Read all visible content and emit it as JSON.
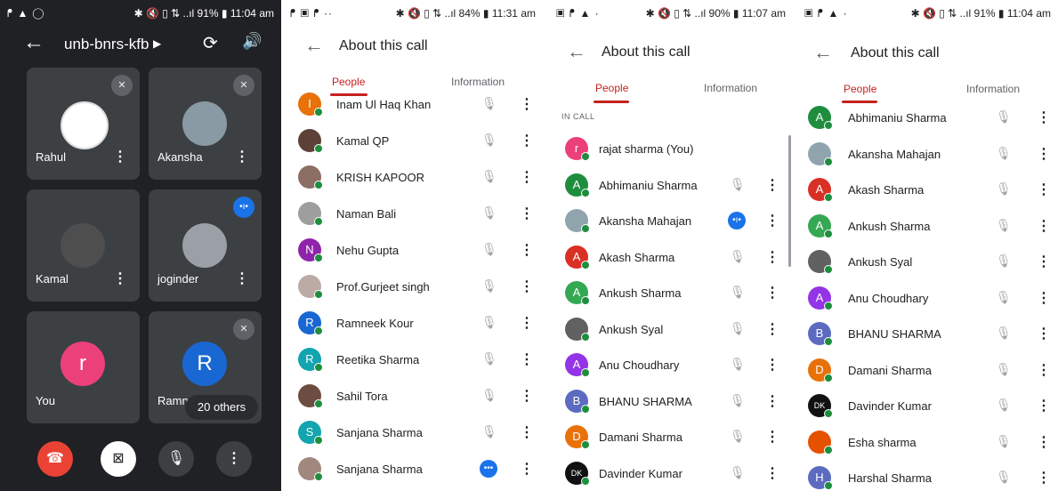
{
  "meet": {
    "status": {
      "left": "ᖰ ▲ ◯",
      "right": "✱ 🔇 ▯ ⇅ ..ıl 91% ▮ 11:04 am"
    },
    "meeting_code": "unb-bnrs-kfb",
    "tiles": [
      {
        "name": "Rahul",
        "muted": true
      },
      {
        "name": "Akansha",
        "muted": true
      },
      {
        "name": "Kamal",
        "muted": false
      },
      {
        "name": "joginder",
        "speaking": true
      },
      {
        "name": "You",
        "initial": "r",
        "color": "#ec407a"
      },
      {
        "name": "Ramne",
        "initial": "R",
        "color": "#1967d2",
        "muted": true
      }
    ],
    "others_label": "20 others"
  },
  "panel2": {
    "status": {
      "left": "ᖰ ▣ ᖰ ··",
      "right": "✱ 🔇 ▯ ⇅ ..ıl 84% ▮ 11:31 am"
    },
    "title": "About this call",
    "tabs": {
      "people": "People",
      "information": "Information"
    },
    "rows": [
      {
        "name": "Inam Ul Haq Khan",
        "initial": "I",
        "color": "#e8710a"
      },
      {
        "name": "Kamal QP",
        "initial": "",
        "color": "#5d4037"
      },
      {
        "name": "KRISH KAPOOR",
        "initial": "",
        "color": "#8d6e63"
      },
      {
        "name": "Naman Bali",
        "initial": "",
        "color": "#9e9e9e"
      },
      {
        "name": "Nehu Gupta",
        "initial": "N",
        "color": "#8e24aa"
      },
      {
        "name": "Prof.Gurjeet singh",
        "initial": "",
        "color": "#bcaaa4"
      },
      {
        "name": "Ramneek Kour",
        "initial": "R",
        "color": "#1967d2"
      },
      {
        "name": "Reetika Sharma",
        "initial": "R",
        "color": "#12a4af"
      },
      {
        "name": "Sahil Tora",
        "initial": "",
        "color": "#6d4c41"
      },
      {
        "name": "Sanjana Sharma",
        "initial": "S",
        "color": "#12a4af"
      },
      {
        "name": "Sanjana Sharma",
        "initial": "",
        "color": "#a1887f",
        "status": "dots"
      }
    ]
  },
  "panel3": {
    "status": {
      "left": "▣ ᖰ ▲ ·",
      "right": "✱ 🔇 ▯ ⇅ ..ıl 90% ▮ 11:07 am"
    },
    "title": "About this call",
    "tabs": {
      "people": "People",
      "information": "Information"
    },
    "in_call": "IN CALL",
    "rows": [
      {
        "name": "rajat sharma (You)",
        "initial": "r",
        "color": "#ec407a",
        "self": true
      },
      {
        "name": "Abhimaniu Sharma",
        "initial": "A",
        "color": "#1e8e3e"
      },
      {
        "name": "Akansha Mahajan",
        "initial": "",
        "color": "#90a4ae",
        "status": "speaking"
      },
      {
        "name": "Akash Sharma",
        "initial": "A",
        "color": "#d93025"
      },
      {
        "name": "Ankush Sharma",
        "initial": "A",
        "color": "#34a853"
      },
      {
        "name": "Ankush Syal",
        "initial": "",
        "color": "#616161"
      },
      {
        "name": "Anu Choudhary",
        "initial": "A",
        "color": "#9334e6"
      },
      {
        "name": "BHANU SHARMA",
        "initial": "B",
        "color": "#5c6bc0"
      },
      {
        "name": "Damani Sharma",
        "initial": "D",
        "color": "#e8710a"
      },
      {
        "name": "Davinder Kumar",
        "initial": "DK",
        "color": "#111111"
      }
    ]
  },
  "panel4": {
    "status": {
      "left": "▣ ᖰ ▲ ·",
      "right": "✱ 🔇 ▯ ⇅ ..ıl 91% ▮ 11:04 am"
    },
    "title": "About this call",
    "tabs": {
      "people": "People",
      "information": "Information"
    },
    "rows": [
      {
        "name": "Abhimaniu Sharma",
        "initial": "A",
        "color": "#1e8e3e"
      },
      {
        "name": "Akansha Mahajan",
        "initial": "",
        "color": "#90a4ae"
      },
      {
        "name": "Akash Sharma",
        "initial": "A",
        "color": "#d93025"
      },
      {
        "name": "Ankush Sharma",
        "initial": "A",
        "color": "#34a853"
      },
      {
        "name": "Ankush Syal",
        "initial": "",
        "color": "#616161"
      },
      {
        "name": "Anu Choudhary",
        "initial": "A",
        "color": "#9334e6"
      },
      {
        "name": "BHANU SHARMA",
        "initial": "B",
        "color": "#5c6bc0"
      },
      {
        "name": "Damani Sharma",
        "initial": "D",
        "color": "#e8710a"
      },
      {
        "name": "Davinder Kumar",
        "initial": "DK",
        "color": "#111111"
      },
      {
        "name": "Esha sharma",
        "initial": "",
        "color": "#e65100"
      },
      {
        "name": "Harshal Sharma",
        "initial": "H",
        "color": "#5c6bc0"
      }
    ]
  }
}
